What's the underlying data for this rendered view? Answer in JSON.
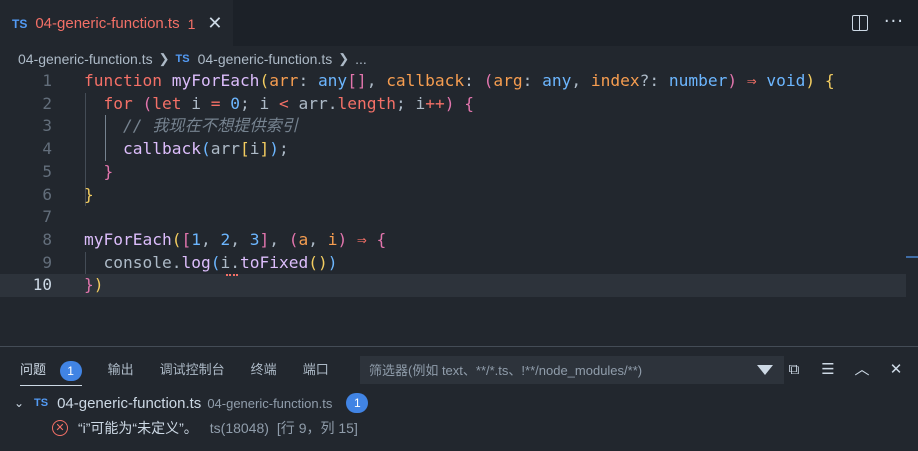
{
  "tab": {
    "badge": "TS",
    "label": "04-generic-function.ts",
    "problem_count": "1",
    "close_glyph": "✕"
  },
  "tab_actions": {
    "split_icon": "split-editor-icon",
    "more_glyph": "···"
  },
  "breadcrumb": {
    "file": "04-generic-function.ts",
    "badge": "TS",
    "symbol": "04-generic-function.ts",
    "ellipsis": "..."
  },
  "editor": {
    "current_line": 10,
    "line_numbers": [
      "1",
      "2",
      "3",
      "4",
      "5",
      "6",
      "7",
      "8",
      "9",
      "10"
    ],
    "lines": [
      [
        [
          "kw",
          "function"
        ],
        [
          "plain",
          " "
        ],
        [
          "fn",
          "myForEach"
        ],
        [
          "b1",
          "("
        ],
        [
          "param",
          "arr"
        ],
        [
          "plain",
          ": "
        ],
        [
          "type",
          "any"
        ],
        [
          "b2",
          "[]"
        ],
        [
          "plain",
          ", "
        ],
        [
          "param",
          "callback"
        ],
        [
          "plain",
          ": "
        ],
        [
          "b2",
          "("
        ],
        [
          "param",
          "arg"
        ],
        [
          "plain",
          ": "
        ],
        [
          "type",
          "any"
        ],
        [
          "plain",
          ", "
        ],
        [
          "param",
          "index"
        ],
        [
          "plain",
          "?: "
        ],
        [
          "type",
          "number"
        ],
        [
          "b2",
          ")"
        ],
        [
          "plain",
          " "
        ],
        [
          "arrow",
          "⇒"
        ],
        [
          "plain",
          " "
        ],
        [
          "type",
          "void"
        ],
        [
          "b1",
          ")"
        ],
        [
          "plain",
          " "
        ],
        [
          "b1",
          "{"
        ]
      ],
      [
        [
          "plain",
          "  "
        ],
        [
          "kw",
          "for"
        ],
        [
          "plain",
          " "
        ],
        [
          "b2",
          "("
        ],
        [
          "kw",
          "let"
        ],
        [
          "plain",
          " i "
        ],
        [
          "arrow",
          "="
        ],
        [
          "plain",
          " "
        ],
        [
          "num",
          "0"
        ],
        [
          "plain",
          "; i "
        ],
        [
          "arrow",
          "<"
        ],
        [
          "plain",
          " arr."
        ],
        [
          "kw",
          "length"
        ],
        [
          "plain",
          "; i"
        ],
        [
          "arrow",
          "++"
        ],
        [
          "b2",
          ")"
        ],
        [
          "plain",
          " "
        ],
        [
          "b2",
          "{"
        ]
      ],
      [
        [
          "plain",
          "    "
        ],
        [
          "comment",
          "// 我现在不想提供索引"
        ]
      ],
      [
        [
          "plain",
          "    "
        ],
        [
          "fn",
          "callback"
        ],
        [
          "b3",
          "("
        ],
        [
          "plain",
          "arr"
        ],
        [
          "b1",
          "["
        ],
        [
          "plain",
          "i"
        ],
        [
          "b1",
          "]"
        ],
        [
          "b3",
          ")"
        ],
        [
          "plain",
          ";"
        ]
      ],
      [
        [
          "plain",
          "  "
        ],
        [
          "b2",
          "}"
        ]
      ],
      [
        [
          "b1",
          "}"
        ]
      ],
      [],
      [
        [
          "fn",
          "myForEach"
        ],
        [
          "b1",
          "("
        ],
        [
          "b2",
          "["
        ],
        [
          "num",
          "1"
        ],
        [
          "plain",
          ", "
        ],
        [
          "num",
          "2"
        ],
        [
          "plain",
          ", "
        ],
        [
          "num",
          "3"
        ],
        [
          "b2",
          "]"
        ],
        [
          "plain",
          ", "
        ],
        [
          "b2",
          "("
        ],
        [
          "param",
          "a"
        ],
        [
          "plain",
          ", "
        ],
        [
          "param",
          "i"
        ],
        [
          "b2",
          ")"
        ],
        [
          "plain",
          " "
        ],
        [
          "arrow",
          "⇒"
        ],
        [
          "plain",
          " "
        ],
        [
          "b2",
          "{"
        ]
      ],
      [
        [
          "plain",
          "  console."
        ],
        [
          "fn",
          "log"
        ],
        [
          "b3",
          "("
        ],
        [
          "plain",
          "i."
        ],
        [
          "fn",
          "toFixed"
        ],
        [
          "b1",
          "()"
        ],
        [
          "b3",
          ")"
        ]
      ],
      [
        [
          "b2",
          "}"
        ],
        [
          "b1",
          ")"
        ]
      ]
    ]
  },
  "panel": {
    "tabs": [
      {
        "label": "问题",
        "active": true,
        "badge": "1"
      },
      {
        "label": "输出",
        "active": false
      },
      {
        "label": "调试控制台",
        "active": false
      },
      {
        "label": "终端",
        "active": false
      },
      {
        "label": "端口",
        "active": false
      }
    ],
    "filter_placeholder": "筛选器(例如 text、**/*.ts、!**/node_modules/**)",
    "filter_icon": "filter-icon",
    "actions": [
      "copy-icon",
      "list-icon",
      "chevron-up-icon",
      "close-icon"
    ],
    "file_group": {
      "chevron": "⌄",
      "badge": "TS",
      "name": "04-generic-function.ts",
      "path": "04-generic-function.ts",
      "count": "1"
    },
    "problem": {
      "icon": "error-icon",
      "message": "“i”可能为“未定义”。",
      "source": "ts(18048)",
      "position": "[行 9，列 15]"
    }
  },
  "colors": {
    "background": "#22272e",
    "tab_error": "#f47067",
    "ts_badge": "#539bf5",
    "badge_blue": "#4184e4"
  }
}
